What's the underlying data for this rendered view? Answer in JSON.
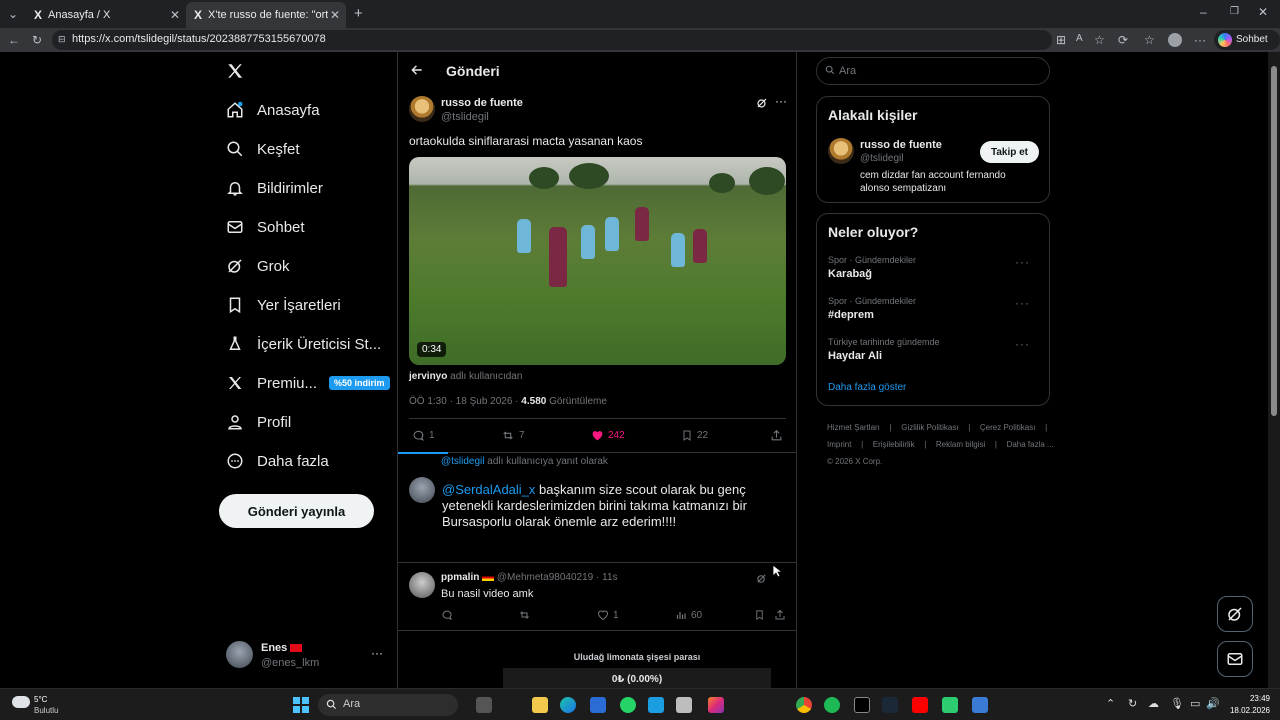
{
  "browser": {
    "tabs": [
      {
        "title": "Anasayfa / X"
      },
      {
        "title": "X'te russo de fuente: \"ortaokulda"
      }
    ],
    "url": "https://x.com/tslidegil/status/2023887753155670078",
    "copilot_label": "Sohbet et"
  },
  "nav": {
    "items": [
      {
        "label": "Anasayfa",
        "icon": "home-icon"
      },
      {
        "label": "Keşfet",
        "icon": "search-icon"
      },
      {
        "label": "Bildirimler",
        "icon": "bell-icon"
      },
      {
        "label": "Sohbet",
        "icon": "mail-icon"
      },
      {
        "label": "Grok",
        "icon": "grok-icon"
      },
      {
        "label": "Yer İşaretleri",
        "icon": "bookmark-icon"
      },
      {
        "label": "İçerik Üreticisi St...",
        "icon": "flask-icon"
      },
      {
        "label": "Premiu...",
        "icon": "x-logo-icon"
      },
      {
        "label": "Profil",
        "icon": "person-icon"
      },
      {
        "label": "Daha fazla",
        "icon": "more-circle-icon"
      }
    ],
    "premium_badge": "%50 indirim",
    "post_button": "Gönderi yayınla",
    "account": {
      "name": "Enes",
      "handle": "@enes_lkm"
    }
  },
  "main": {
    "header_title": "Gönderi",
    "tweet": {
      "author": "russo de fuente",
      "handle": "@tslidegil",
      "text": "ortaokulda siniflararasi macta yasanan kaos",
      "video_duration": "0:34",
      "from_user": "jervinyo",
      "from_suffix": "adlı kullanıcıdan",
      "time": "ÖÖ 1:30 · 18 Şub 2026 ·",
      "views": "4.580",
      "views_label": "Görüntüleme",
      "replies": "1",
      "retweets": "7",
      "likes": "242",
      "bookmarks": "22"
    },
    "reply_context": {
      "handle": "@tslidegil",
      "suffix": "adlı kullanıcıya yanıt olarak"
    },
    "reply_draft": {
      "mention": "@SerdalAdali_x",
      "text": " başkanım size scout olarak bu genç yetenekli kardeslerimizden birini takıma katmanızı bir Bursasporlu olarak önemle arz ederim!!!!"
    },
    "reply": {
      "author": "ppmalin",
      "handle": "@Mehmeta98040219 · 11s",
      "text": "Bu nasil video amk",
      "likes": "1",
      "views": "60"
    }
  },
  "right": {
    "search_placeholder": "Ara",
    "related_title": "Alakalı kişiler",
    "person": {
      "name": "russo de fuente",
      "handle": "@tslidegil",
      "bio": "cem dizdar fan account fernando alonso sempatizanı",
      "follow_label": "Takip et"
    },
    "trends_title": "Neler oluyor?",
    "trends": [
      {
        "meta": "Spor · Gündemdekiler",
        "title": "Karabağ"
      },
      {
        "meta": "Spor · Gündemdekiler",
        "title": "#deprem"
      },
      {
        "meta": "Türkiye tarihinde gündemde",
        "title": "Haydar Ali"
      }
    ],
    "show_more": "Daha fazla göster",
    "footer": {
      "links": [
        "Hizmet Şartları",
        "Gizlilik Politikası",
        "Çerez Politikası",
        "Imprint",
        "Erişilebilirlik",
        "Reklam bilgisi",
        "Daha fazla ..."
      ],
      "copyright": "© 2026 X Corp."
    }
  },
  "overlay": {
    "ticker_title": "Uludağ limonata şişesi parası",
    "ticker_value": "0₺ (0.00%)"
  },
  "taskbar": {
    "weather_temp": "5°C",
    "weather_desc": "Bulutlu",
    "search_placeholder": "Ara",
    "time": "23:49",
    "date": "18.02.2026"
  },
  "colors": {
    "accent": "#1d9bf0",
    "like": "#f91880",
    "bg": "#000000",
    "border": "#2f3336"
  }
}
